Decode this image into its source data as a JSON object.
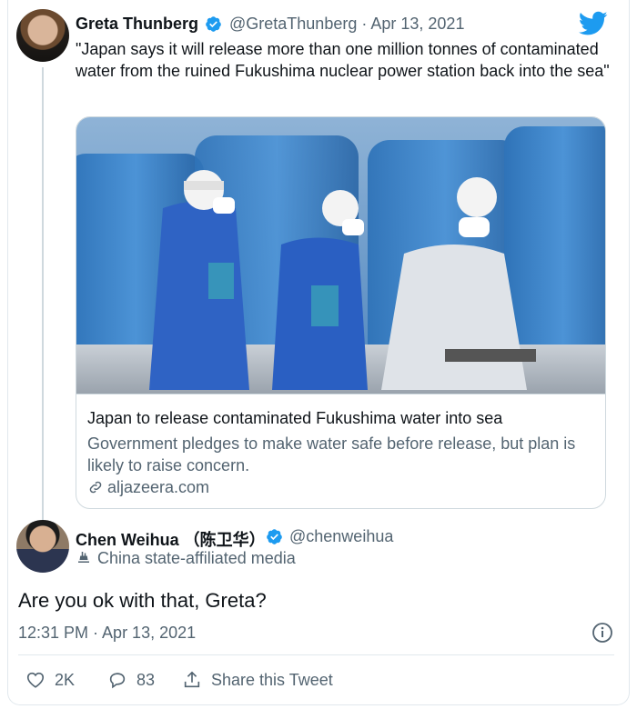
{
  "quoted_tweet": {
    "name": "Greta Thunberg",
    "handle": "@GretaThunberg",
    "separator": "·",
    "date": "Apr 13, 2021",
    "text": "\"Japan says it will release more than one million tonnes of contaminated water from the ruined Fukushima nuclear power station back into the sea\"",
    "link_card": {
      "title": "Japan to release contaminated Fukushima water into sea",
      "description": "Government pledges to make water safe before release, but plan is likely to raise concern.",
      "domain": "aljazeera.com"
    }
  },
  "main_tweet": {
    "name": "Chen Weihua （陈卫华）",
    "handle": "@chenweihua",
    "affiliation": "China state-affiliated media",
    "text": "Are you ok with that, Greta?",
    "timestamp": "12:31 PM · Apr 13, 2021",
    "actions": {
      "likes": "2K",
      "replies": "83",
      "share_label": "Share this Tweet"
    }
  },
  "colors": {
    "brand": "#1d9bf0",
    "text": "#0f1419",
    "secondary": "#536471",
    "border": "#cfd9de"
  },
  "icons": [
    "twitter-bird-icon",
    "verified-badge-icon",
    "link-icon",
    "state-media-icon",
    "info-icon",
    "heart-icon",
    "reply-icon",
    "share-icon"
  ]
}
